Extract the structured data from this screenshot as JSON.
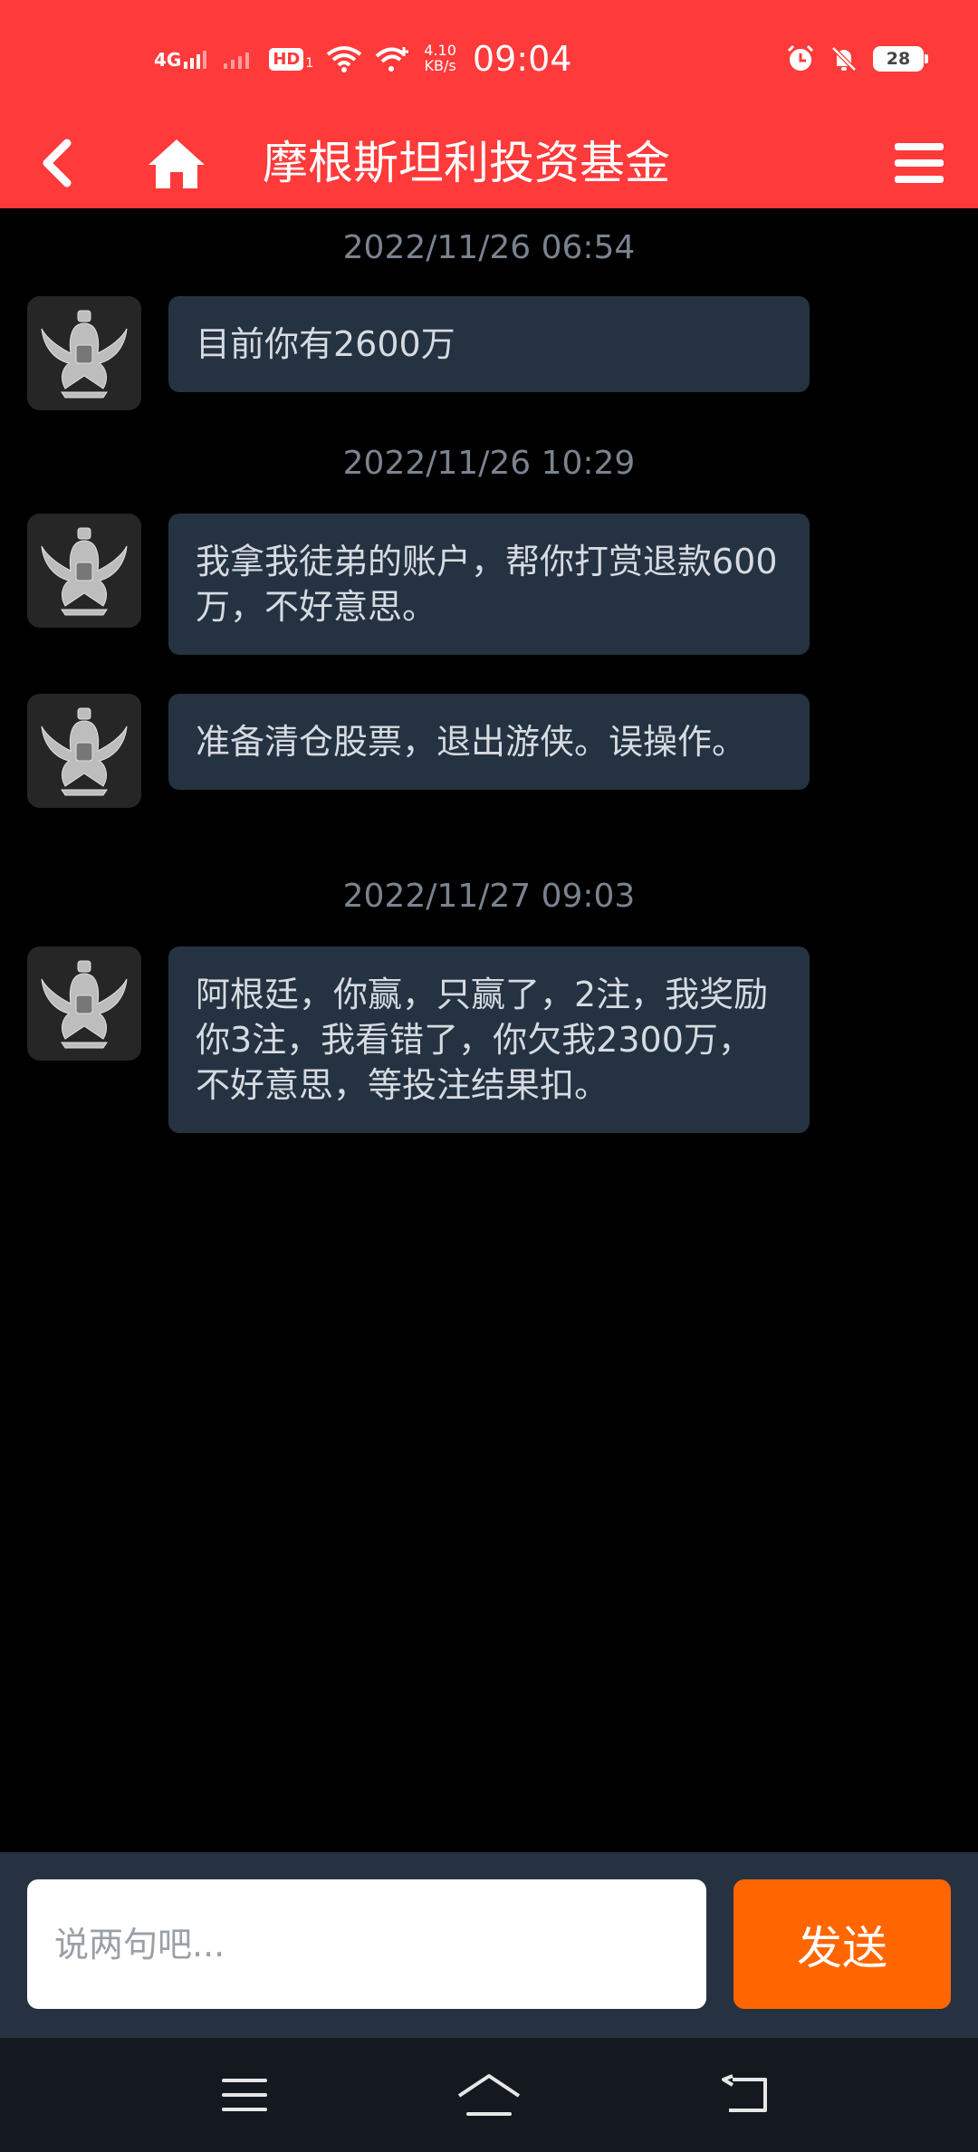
{
  "status_bar": {
    "network_label": "4G",
    "network2_label": "HD",
    "speed_value": "4.10",
    "speed_unit": "KB/s",
    "time": "09:04",
    "battery": "28"
  },
  "header": {
    "title": "摩根斯坦利投资基金",
    "back_icon": "chevron-left-icon",
    "home_icon": "home-icon",
    "menu_icon": "hamburger-menu-icon",
    "color": "#ff3a3a"
  },
  "chat": {
    "timestamps": [
      "2022/11/26 06:54",
      "2022/11/26 10:29",
      "2022/11/27 09:03"
    ],
    "messages": [
      {
        "text": "目前你有2600万"
      },
      {
        "text": "我拿我徒弟的账户，帮你打赏退款600万，不好意思。"
      },
      {
        "text": "准备清仓股票，退出游侠。误操作。"
      },
      {
        "text": "阿根廷，你赢，只赢了，2注，我奖励你3注，我看错了，你欠我2300万，不好意思，等投注结果扣。"
      }
    ],
    "bubble_color": "#253241"
  },
  "input": {
    "placeholder": "说两句吧...",
    "value": "",
    "send_label": "发送",
    "send_color": "#ff6600"
  },
  "system_nav": {
    "items": [
      "menu-icon",
      "home-outline-icon",
      "back-return-icon"
    ]
  }
}
